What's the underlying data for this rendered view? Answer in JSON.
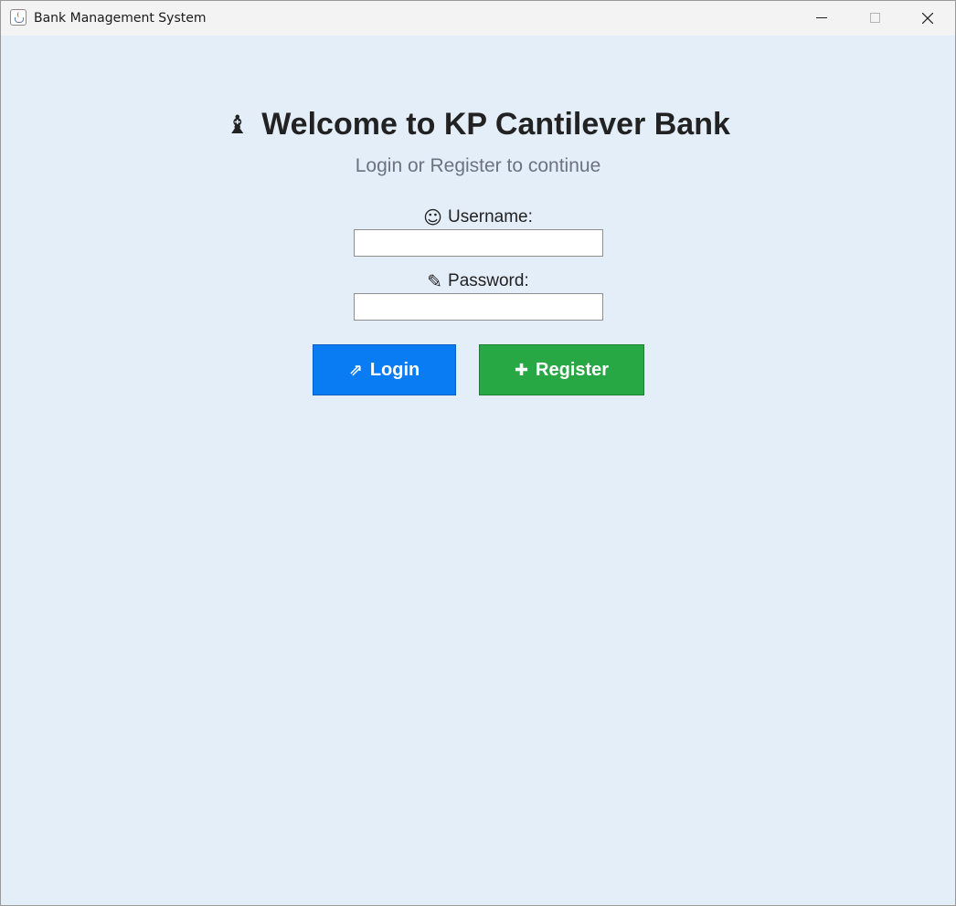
{
  "window": {
    "title": "Bank Management System"
  },
  "header": {
    "icon": "♝",
    "icon_name": "chess-pawn-icon",
    "title": "Welcome to KP Cantilever Bank",
    "subtitle": "Login or Register to continue"
  },
  "form": {
    "username": {
      "icon": "☺",
      "label": "Username:",
      "value": ""
    },
    "password": {
      "icon": "✎",
      "label": "Password:",
      "value": ""
    }
  },
  "buttons": {
    "login": {
      "icon": "⇗",
      "label": "Login",
      "color": "#0a7cf3"
    },
    "register": {
      "icon": "✚",
      "label": "Register",
      "color": "#28a745"
    }
  },
  "colors": {
    "background": "#e3eef9",
    "titlebar": "#f3f3f3"
  }
}
